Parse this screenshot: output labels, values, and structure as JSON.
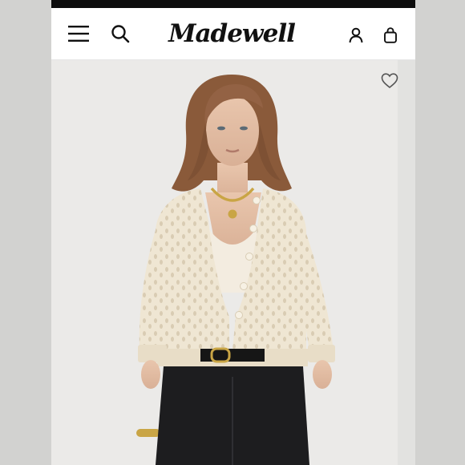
{
  "header": {
    "brand": "Madewell",
    "icons": [
      "menu-icon",
      "search-icon",
      "account-icon",
      "bag-icon"
    ]
  },
  "product": {
    "image": "model-wearing-cream-pointelle-cardigan",
    "wishlist_icon": "heart-icon"
  },
  "colors": {
    "header_bg": "#ffffff",
    "status_strip": "#0d0d0d",
    "photo_bg": "#ecebe9",
    "cardigan": "#efe6d3",
    "jeans": "#1d1d1f"
  }
}
